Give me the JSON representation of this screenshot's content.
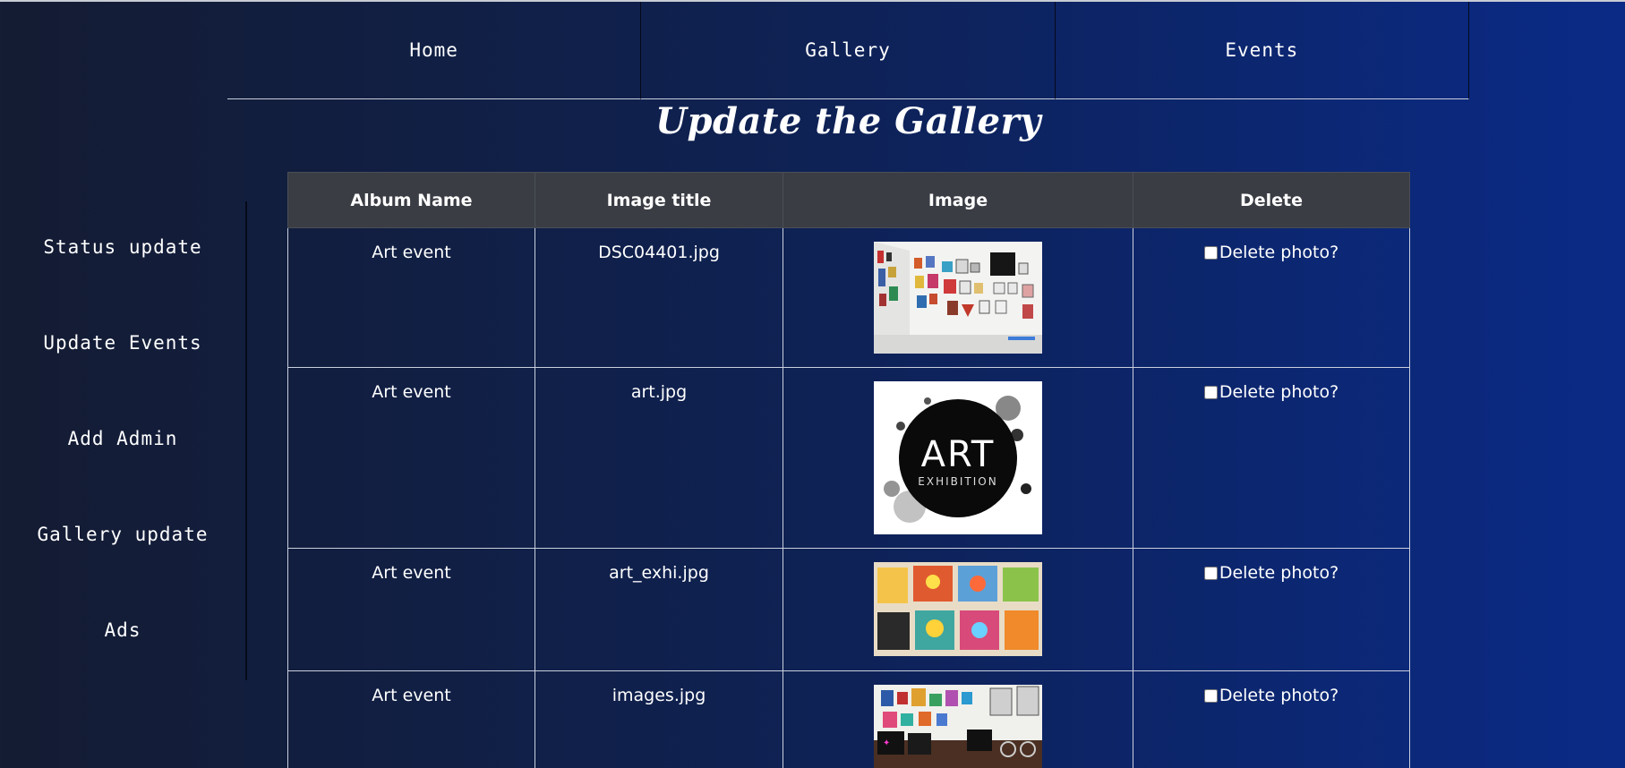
{
  "nav": {
    "items": [
      "Home",
      "Gallery",
      "Events"
    ]
  },
  "page": {
    "title": "Update the Gallery"
  },
  "sidebar": {
    "items": [
      "Status update",
      "Update Events",
      "Add Admin",
      "Gallery update",
      "Ads"
    ]
  },
  "table": {
    "headers": [
      "Album Name",
      "Image title",
      "Image",
      "Delete"
    ],
    "rows": [
      {
        "album": "Art event",
        "title": "DSC04401.jpg",
        "image_icon": "gallery-wall-photo",
        "delete_label": "Delete photo?"
      },
      {
        "album": "Art event",
        "title": "art.jpg",
        "image_icon": "art-exhibition-logo",
        "image_text": "ART",
        "image_subtext": "EXHIBITION",
        "delete_label": "Delete photo?"
      },
      {
        "album": "Art event",
        "title": "art_exhi.jpg",
        "image_icon": "kids-paintings-photo",
        "delete_label": "Delete photo?"
      },
      {
        "album": "Art event",
        "title": "images.jpg",
        "image_icon": "gallery-room-photo",
        "delete_label": "Delete photo?"
      }
    ]
  },
  "colors": {
    "background_start": "#141c33",
    "background_end": "#0a2a86",
    "header_row": "#3a3d44",
    "border": "#c9cfdc"
  }
}
